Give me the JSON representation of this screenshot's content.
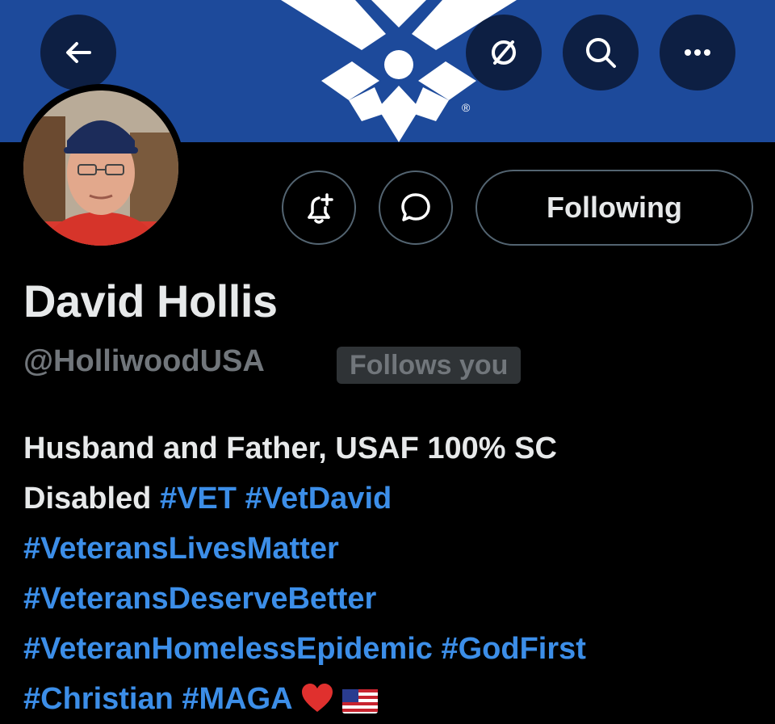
{
  "profile": {
    "name": "David Hollis",
    "handle": "@HolliwoodUSA",
    "follows_you_label": "Follows you",
    "following_label": "Following",
    "banner_trademark": "®"
  },
  "bio": {
    "line1_text": "Husband and Father, USAF 100% SC",
    "line2_text": "Disabled",
    "line2_tags": [
      "#VET",
      "#VetDavid"
    ],
    "line3_tags": [
      "#VeteransLivesMatter"
    ],
    "line4_tags": [
      "#VeteransDeserveBetter"
    ],
    "line5_tags": [
      "#VeteranHomelessEpidemic",
      "#GodFirst"
    ],
    "line6_tags": [
      "#Christian",
      "#MAGA"
    ],
    "emojis": [
      "red-heart",
      "us-flag"
    ]
  },
  "colors": {
    "banner": "#1d4a9b",
    "hashtag": "#3c8ee8",
    "muted": "#71767b",
    "text": "#e7e9ea",
    "button_border": "#536471"
  },
  "icons": [
    "back-arrow-icon",
    "link-slash-icon",
    "search-icon",
    "more-icon",
    "notification-plus-icon",
    "message-icon"
  ]
}
